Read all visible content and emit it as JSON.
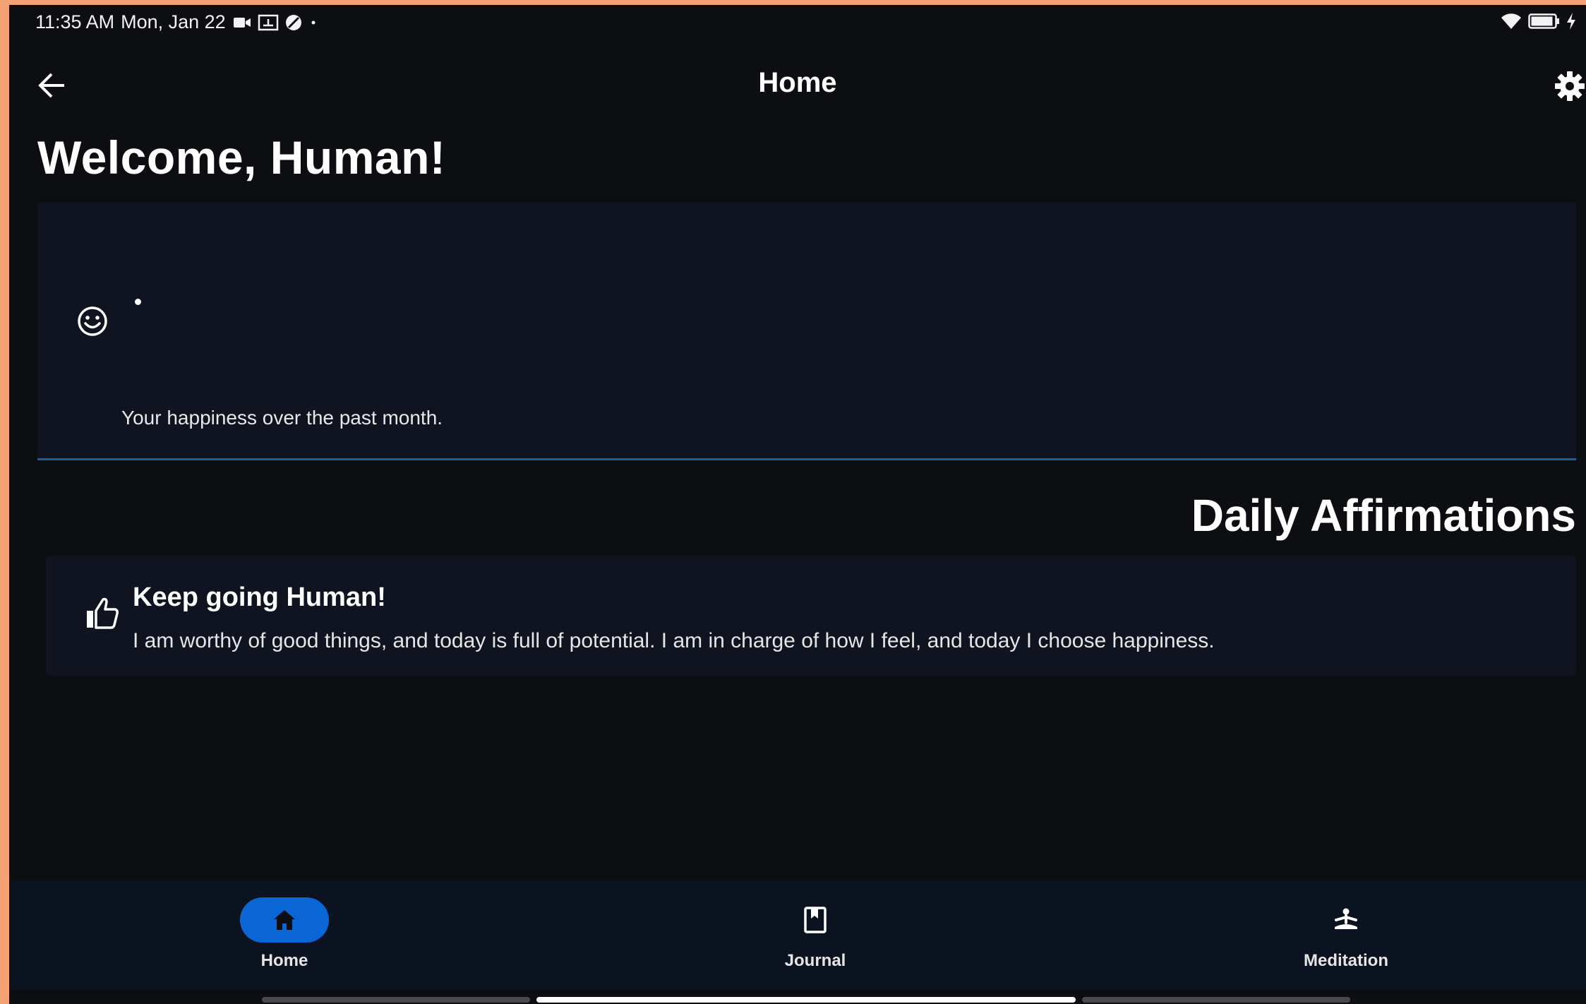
{
  "status_bar": {
    "time": "11:35 AM",
    "date": "Mon, Jan 22",
    "battery_level": "84"
  },
  "app_bar": {
    "title": "Home"
  },
  "welcome": {
    "text": "Welcome, Human!"
  },
  "happiness": {
    "caption": "Your happiness over the past month."
  },
  "affirmations": {
    "section_title": "Daily Affirmations",
    "title": "Keep going Human!",
    "text": "I am worthy of good things, and today is full of potential. I am in charge of how I feel, and today I choose happiness."
  },
  "bottom_nav": {
    "items": [
      {
        "label": "Home",
        "icon": "home-icon",
        "selected": true
      },
      {
        "label": "Journal",
        "icon": "journal-icon",
        "selected": false
      },
      {
        "label": "Meditation",
        "icon": "meditation-icon",
        "selected": false
      }
    ]
  },
  "colors": {
    "background": "#0d0e11",
    "card": "#101420",
    "accent": "#0a66d4",
    "divider": "#1a5e9c",
    "frame": "#f4a273"
  }
}
